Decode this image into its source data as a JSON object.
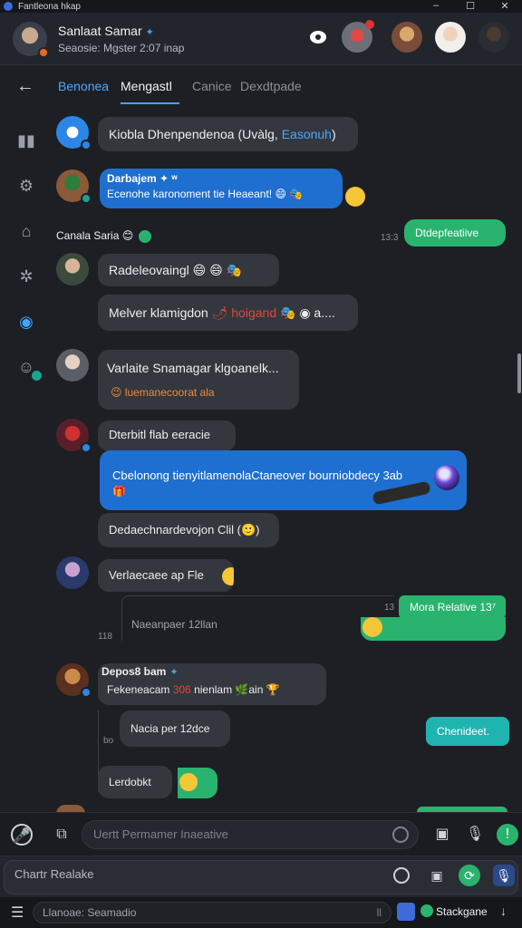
{
  "window": {
    "title": "Fantleona hkap",
    "controls": [
      "–",
      "☐",
      "✕"
    ]
  },
  "header": {
    "name": "Sanlaat Samar",
    "subtitle": "Seaosie: Mgster 2:07 inap",
    "verified_icon": "✦",
    "avatars": [
      "avatar-contact-1",
      "avatar-contact-2",
      "avatar-contact-3",
      "avatar-contact-4"
    ]
  },
  "tabs": {
    "back": "←",
    "items": [
      "Benonea",
      "Mengastl",
      "Canice",
      "Dexdtpade"
    ]
  },
  "rail": {
    "icons": [
      "▮▮",
      "⚙",
      "⌂",
      "✲",
      "◉",
      "☺"
    ]
  },
  "messages": {
    "m1": {
      "text": "Kiobla Dhenpendenoa (Uvàlg, ",
      "link": "Easonuh",
      "tail": ")"
    },
    "m2": {
      "title": "Darbajem",
      "verified": "✦ ʷ",
      "text": "Ecenohe karonoment tie Heaeant! 😄 🎭"
    },
    "sender1": "Canala Saria 😊",
    "ts1": "13:3",
    "m3": "Dtdepfeatiive",
    "m4": "Radeleovaingl 😄 😄 🎭",
    "m5": {
      "text": "Melver klamigdon ",
      "red": "🌶 hoigand",
      "tail": " 🎭 ◉ a...."
    },
    "m6": {
      "text": "Varlaite Snamagar klgoanelk...",
      "sub": "😉 luemanecoorat ala"
    },
    "m7": "Dterbitl flab eeracie",
    "m8": {
      "text": "Cbelonong tienyitlamenolaCtaneover bourniobdecy 3ab",
      "sub": "🎁"
    },
    "m9": "Dedaechnardevojon Clil (🙂)",
    "m10": "Verlaecaee ap Fle",
    "thread1": "Naeanpaer 12llan",
    "ts2": "118",
    "ts3": "13",
    "m11": "Mora Relative 13⁷",
    "m12": {
      "title": "Depos8 bam",
      "verified": "✦",
      "text": "Fekeneacam ",
      "red": "306",
      "tail": " nienlam 🌿ain 🏆"
    },
    "ts4": "bo",
    "m13": "Nacia per 12dce",
    "m14": "Chenideet.",
    "m15": "Lerdobkt"
  },
  "composer": {
    "placeholder": "Uertt Permamer Inaeative",
    "mic": "🎤",
    "attach": "⧉",
    "camera": "▣",
    "voice": "🎙",
    "send": "!"
  },
  "bar2": {
    "text": "Chartr Realake",
    "mic": "⊙",
    "cam": "▣",
    "green": "⟳",
    "mic2": "🎙"
  },
  "taskbar": {
    "menu": "☰",
    "search": "Llanoae: Seamadio",
    "search_key": "ll",
    "label": "Stackgane",
    "arrow": "↓"
  }
}
